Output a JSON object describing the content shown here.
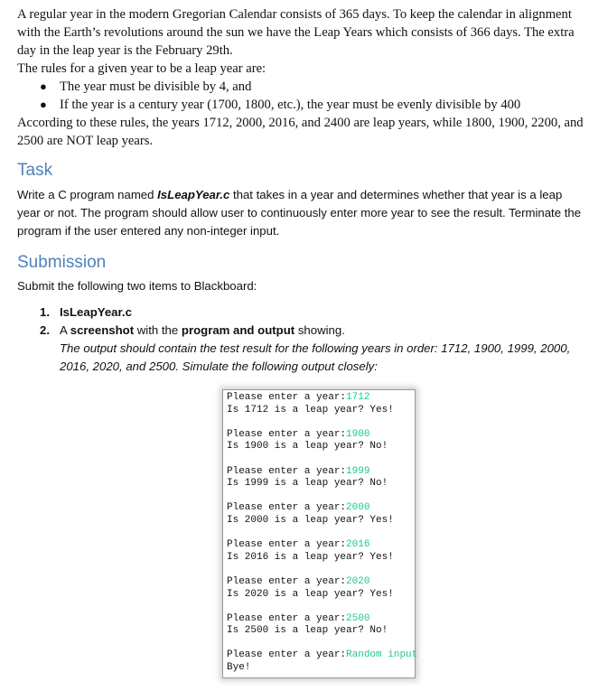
{
  "intro": {
    "paragraph": "A regular year in the modern Gregorian Calendar consists of 365 days. To keep the calendar in alignment with the Earth’s revolutions around the sun we have the Leap Years which consists of 366 days. The extra day in the leap year is the February 29th.",
    "rules_lead": "The rules for a given year to be a leap year are:",
    "rules": [
      "The year must be divisible by 4, and",
      "If the year is a century year (1700, 1800, etc.), the year must be evenly divisible by 400"
    ],
    "conclusion": "According to these rules, the years 1712, 2000, 2016, and 2400 are leap years, while 1800, 1900, 2200, and 2500 are NOT leap years."
  },
  "task": {
    "heading": "Task",
    "text_before": "Write a C program named ",
    "filename": "IsLeapYear.c",
    "text_after": " that takes in a year and determines whether that year is a leap year or not. The program should allow user to continuously enter more year to see the result. Terminate the program if the user entered any non-integer input."
  },
  "submission": {
    "heading": "Submission",
    "lead": "Submit the following two items to Blackboard:",
    "items": [
      {
        "number": "1.",
        "bold": "IsLeapYear.c"
      },
      {
        "number": "2.",
        "part1": "A ",
        "bold1": "screenshot",
        "part2": " with the ",
        "bold2": "program and output",
        "part3": " showing.",
        "italic": "The output should contain the test result for the following years in order: 1712, 1900, 1999, 2000, 2016, 2020, and 2500. Simulate the following output closely:"
      }
    ]
  },
  "console": {
    "prompt": "Please enter a year:",
    "accent_color": "#1ec98a",
    "blocks": [
      {
        "input": "1712",
        "result": "Is 1712 is a leap year? Yes!"
      },
      {
        "input": "1900",
        "result": "Is 1900 is a leap year? No!"
      },
      {
        "input": "1999",
        "result": "Is 1999 is a leap year? No!"
      },
      {
        "input": "2000",
        "result": "Is 2000 is a leap year? Yes!"
      },
      {
        "input": "2016",
        "result": "Is 2016 is a leap year? Yes!"
      },
      {
        "input": "2020",
        "result": "Is 2020 is a leap year? Yes!"
      },
      {
        "input": "2500",
        "result": "Is 2500 is a leap year? No!"
      },
      {
        "input": "Random input",
        "result": "Bye!"
      }
    ]
  }
}
